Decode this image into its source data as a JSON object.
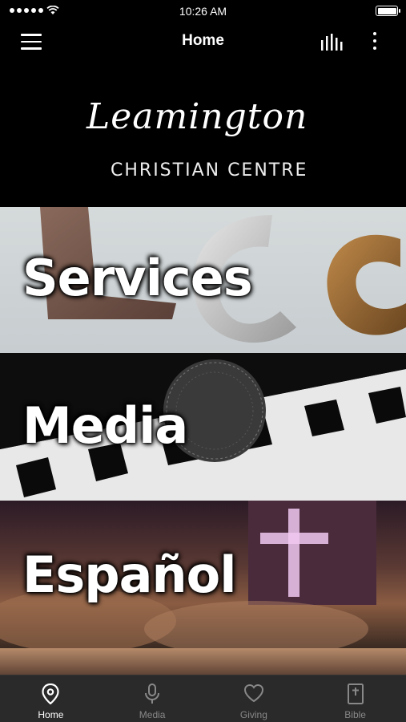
{
  "status": {
    "time": "10:26 AM"
  },
  "nav": {
    "title": "Home"
  },
  "logo": {
    "script": "Leamington",
    "sub": "CHRISTIAN CENTRE"
  },
  "tiles": [
    {
      "label": "Services"
    },
    {
      "label": "Media"
    },
    {
      "label": "Español"
    }
  ],
  "tabs": [
    {
      "label": "Home",
      "icon": "location-pin-icon",
      "active": true
    },
    {
      "label": "Media",
      "icon": "microphone-icon",
      "active": false
    },
    {
      "label": "Giving",
      "icon": "heart-icon",
      "active": false
    },
    {
      "label": "Bible",
      "icon": "bible-icon",
      "active": false
    }
  ],
  "colors": {
    "background": "#000000",
    "tabbar": "#2a2a2a",
    "tab_inactive": "#888888",
    "tab_active": "#ffffff"
  }
}
